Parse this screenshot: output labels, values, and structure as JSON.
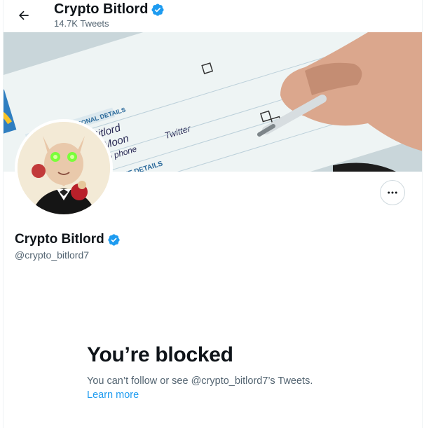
{
  "header": {
    "name": "Crypto Bitlord",
    "tweet_count": "14.7K Tweets"
  },
  "banner": {
    "form_text": {
      "section_heading": "SECTION 1: PERSONAL DETAILS",
      "employment_heading": "EMPLOYMENT DETAILS",
      "handwritten_1": "Bitlord",
      "handwritten_2": "Moon",
      "handwritten_3": "No phone",
      "handwritten_4": "Twitter"
    }
  },
  "profile": {
    "name": "Crypto Bitlord",
    "handle": "@crypto_bitlord7"
  },
  "blocked": {
    "title": "You’re blocked",
    "description": "You can’t follow or see @crypto_bitlord7’s Tweets.",
    "learn_more": "Learn more"
  },
  "colors": {
    "verified": "#1d9bf0",
    "link": "#1d9bf0",
    "secondary_text": "#536471"
  }
}
